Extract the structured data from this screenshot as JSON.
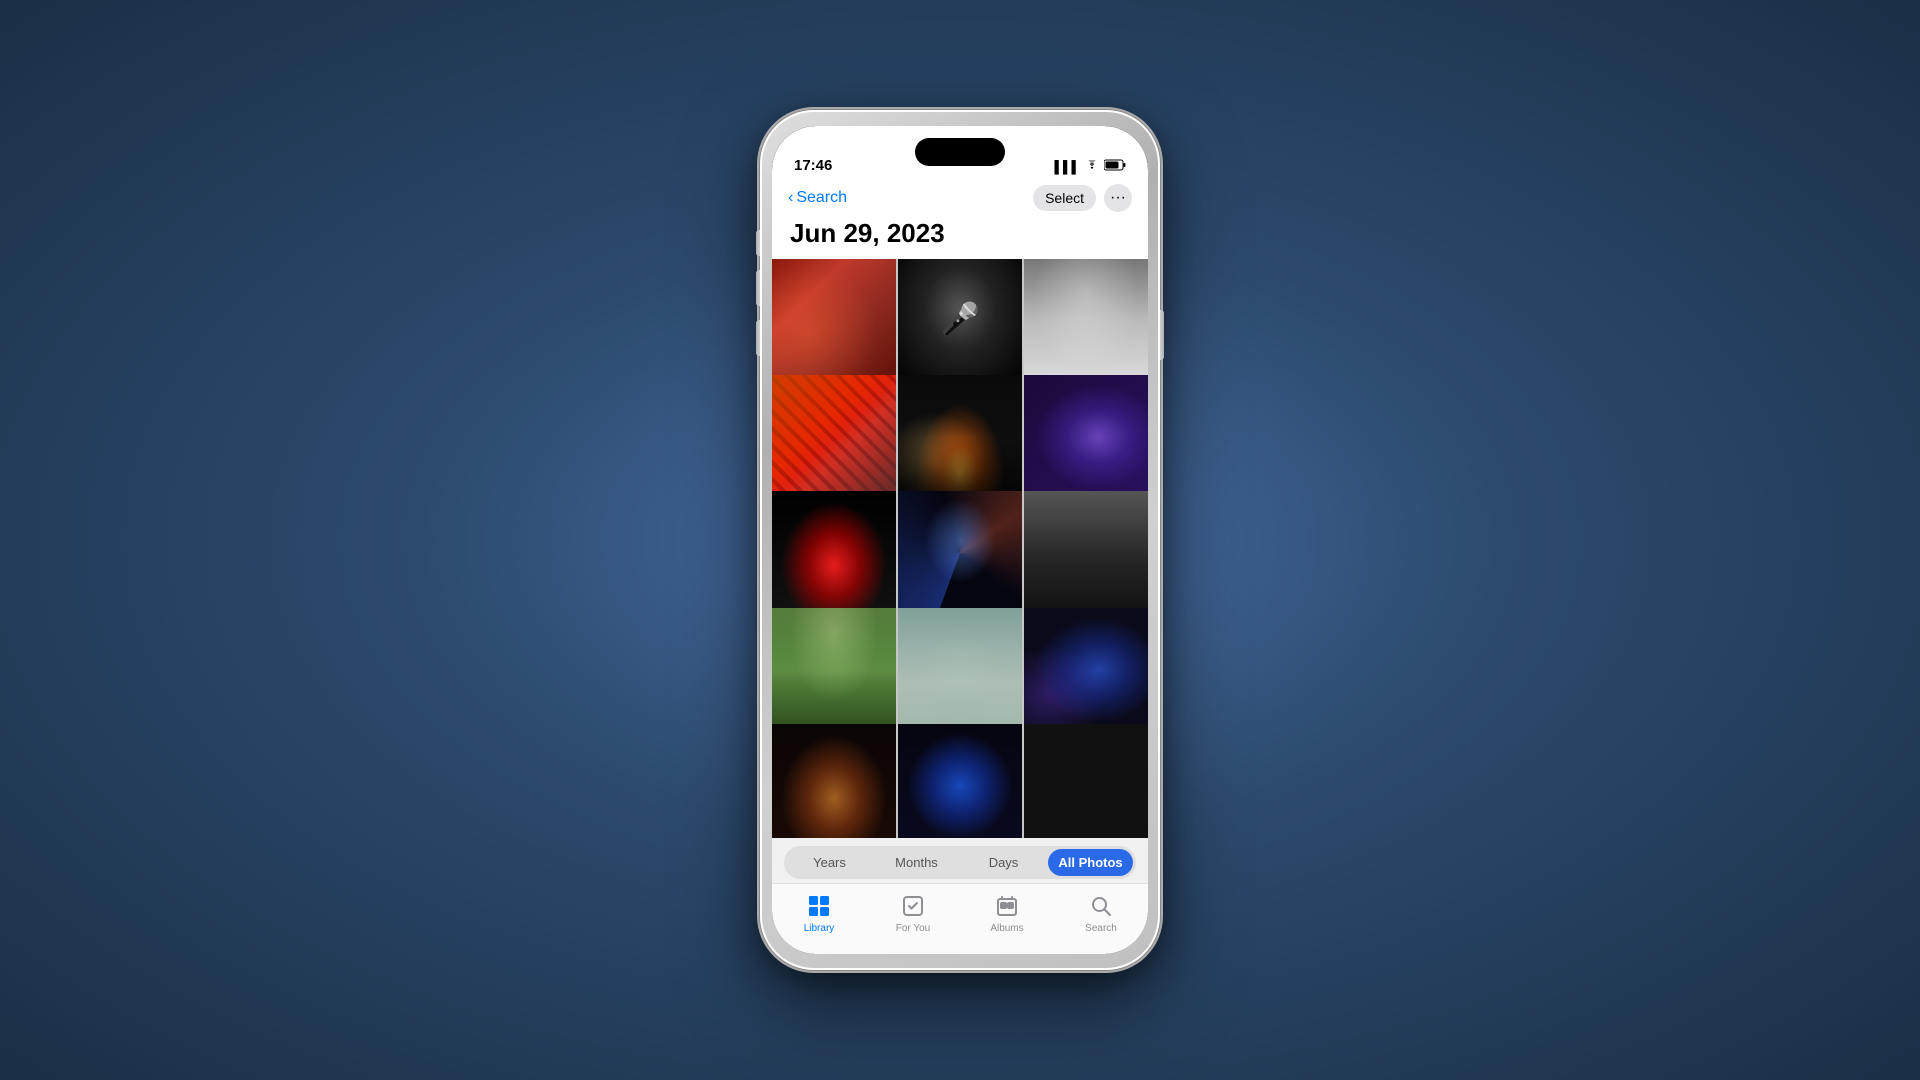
{
  "device": {
    "time": "17:46"
  },
  "header": {
    "back_label": "Search",
    "date_title": "Jun 29, 2023",
    "select_label": "Select",
    "more_label": "···"
  },
  "view_tabs": {
    "options": [
      "Years",
      "Months",
      "Days",
      "All Photos"
    ],
    "active": "All Photos"
  },
  "tab_bar": {
    "items": [
      {
        "id": "library",
        "label": "Library",
        "icon": "🖼",
        "active": true
      },
      {
        "id": "for-you",
        "label": "For You",
        "icon": "❤",
        "active": false
      },
      {
        "id": "albums",
        "label": "Albums",
        "icon": "📁",
        "active": false
      },
      {
        "id": "search",
        "label": "Search",
        "icon": "🔍",
        "active": false
      }
    ]
  },
  "photos": {
    "count": 14
  }
}
